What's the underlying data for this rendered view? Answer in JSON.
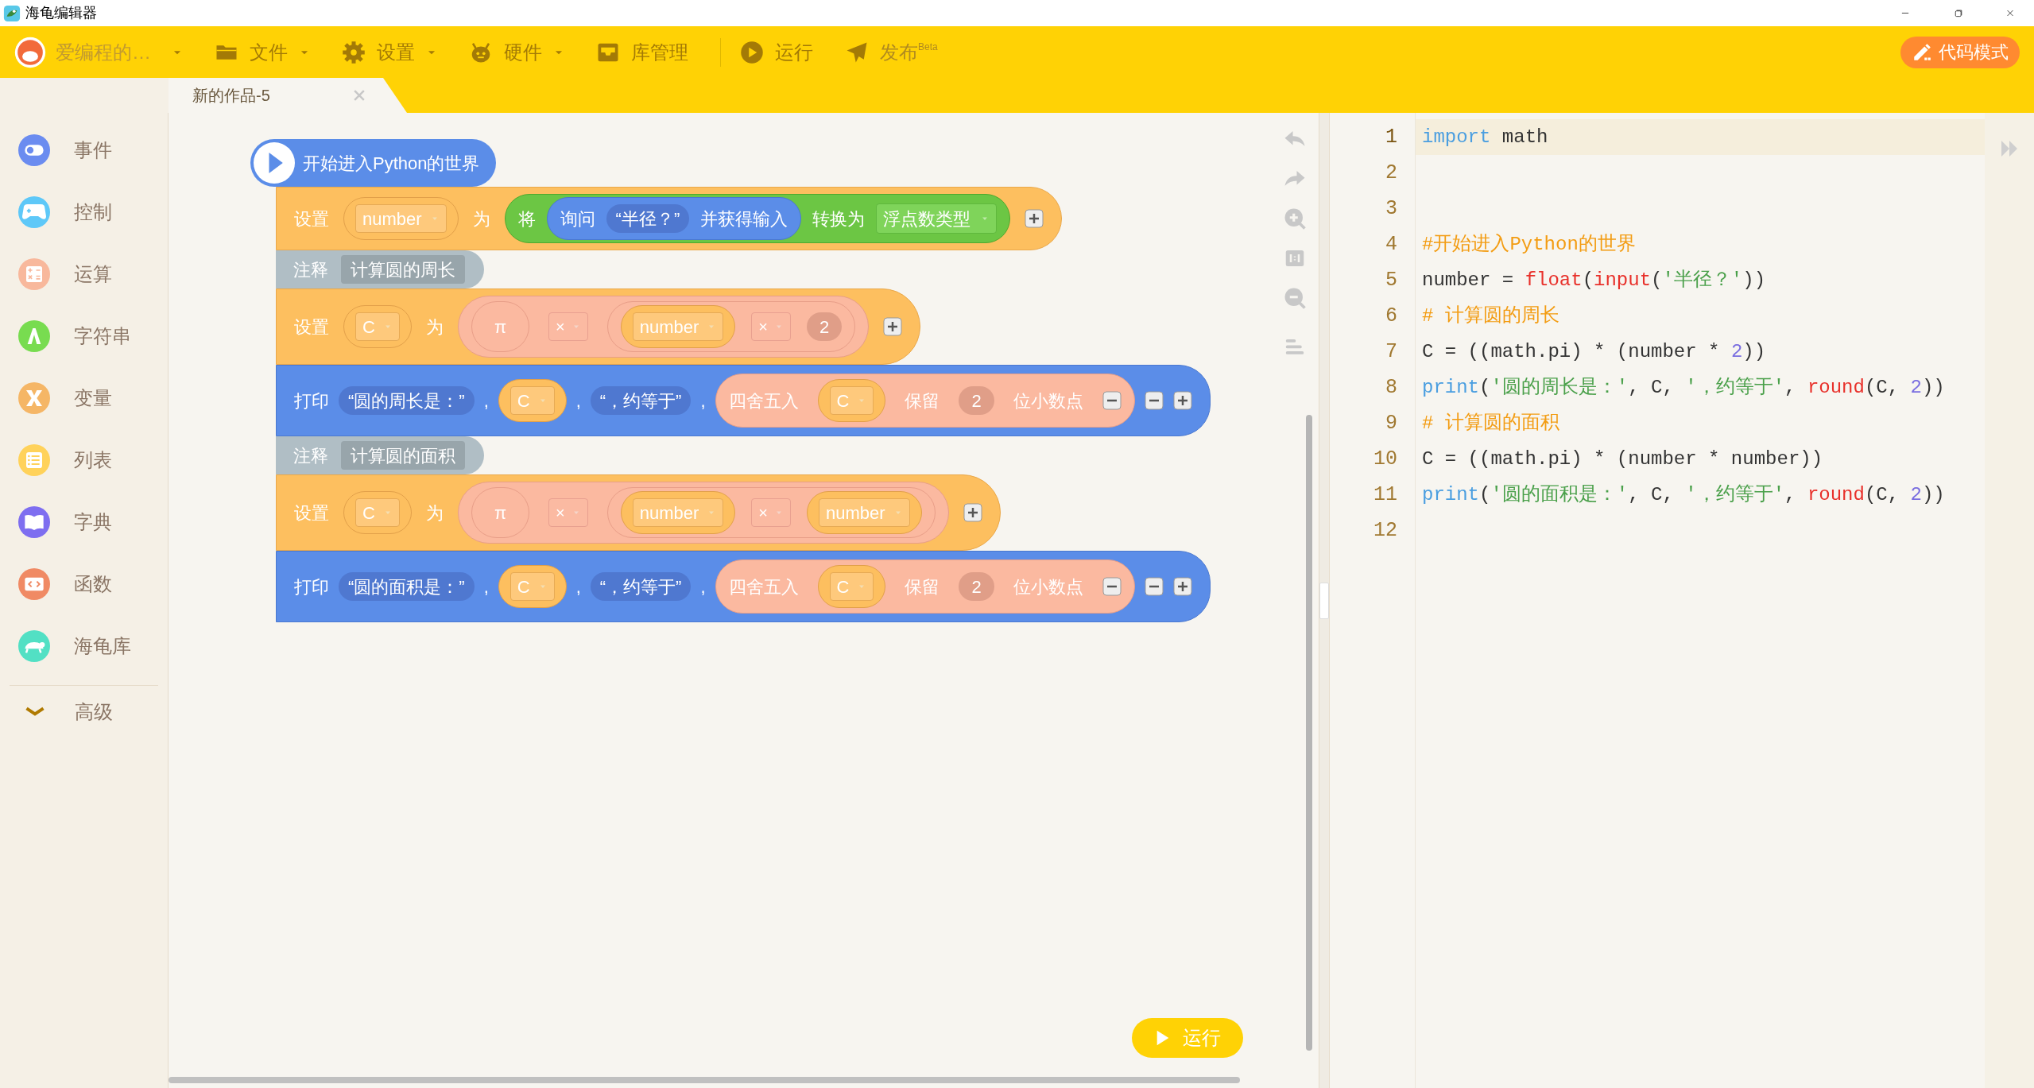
{
  "window": {
    "title": "海龟编辑器"
  },
  "toolbar": {
    "user": "爱编程的…",
    "items": [
      {
        "label": "文件",
        "kind": "menu"
      },
      {
        "label": "设置",
        "kind": "menu"
      },
      {
        "label": "硬件",
        "kind": "menu"
      },
      {
        "label": "库管理",
        "kind": "action"
      },
      {
        "label": "运行",
        "kind": "action"
      },
      {
        "label": "发布",
        "kind": "publish",
        "badge": "Beta"
      }
    ],
    "mode_button": "代码模式"
  },
  "tabs": [
    {
      "label": "新的作品-5",
      "selected": true
    }
  ],
  "categories": [
    {
      "label": "事件",
      "color": "#6b8cf0"
    },
    {
      "label": "控制",
      "color": "#5ec8f8"
    },
    {
      "label": "运算",
      "color": "#f8b89c"
    },
    {
      "label": "字符串",
      "color": "#78dc50"
    },
    {
      "label": "变量",
      "color": "#f5b666"
    },
    {
      "label": "列表",
      "color": "#ffd25a"
    },
    {
      "label": "字典",
      "color": "#7e6ef0"
    },
    {
      "label": "函数",
      "color": "#f08a64"
    },
    {
      "label": "海龟库",
      "color": "#52e0c4"
    }
  ],
  "advanced": "高级",
  "blocks": [
    {
      "kind": "start",
      "label": "开始进入Python的世界"
    },
    {
      "kind": "set",
      "parts": [
        {
          "kind": "label",
          "text": "设置"
        },
        {
          "kind": "var",
          "text": "number"
        },
        {
          "kind": "label",
          "text": "为"
        },
        {
          "kind": "convert",
          "parts": [
            {
              "kind": "label",
              "text": "将"
            },
            {
              "kind": "ask",
              "parts": [
                {
                  "kind": "label",
                  "text": "询问"
                },
                {
                  "kind": "string",
                  "text": "“半径？”"
                },
                {
                  "kind": "label",
                  "text": "并获得输入"
                }
              ]
            },
            {
              "kind": "label",
              "text": "转换为"
            },
            {
              "kind": "dropdown",
              "text": "浮点数类型"
            }
          ]
        },
        {
          "kind": "plus"
        }
      ]
    },
    {
      "kind": "comment",
      "parts": [
        {
          "kind": "label",
          "text": "注释"
        },
        {
          "kind": "note",
          "text": "计算圆的周长"
        }
      ]
    },
    {
      "kind": "set",
      "parts": [
        {
          "kind": "label",
          "text": "设置"
        },
        {
          "kind": "var",
          "text": "C"
        },
        {
          "kind": "label",
          "text": "为"
        },
        {
          "kind": "arith",
          "parts": [
            {
              "kind": "const",
              "text": "π"
            },
            {
              "kind": "op",
              "text": "×"
            },
            {
              "kind": "inner",
              "parts": [
                {
                  "kind": "var",
                  "text": "number"
                },
                {
                  "kind": "op",
                  "text": "×"
                },
                {
                  "kind": "num",
                  "text": "2"
                }
              ]
            }
          ]
        },
        {
          "kind": "plus"
        }
      ]
    },
    {
      "kind": "print",
      "parts": [
        {
          "kind": "label",
          "text": "打印"
        },
        {
          "kind": "string",
          "text": "“圆的周长是：”"
        },
        {
          "kind": "label",
          "text": ","
        },
        {
          "kind": "var",
          "text": "C"
        },
        {
          "kind": "label",
          "text": ","
        },
        {
          "kind": "string",
          "text": "“，约等于”"
        },
        {
          "kind": "label",
          "text": ","
        },
        {
          "kind": "arith",
          "parts": [
            {
              "kind": "label",
              "text": "四舍五入"
            },
            {
              "kind": "var",
              "text": "C"
            },
            {
              "kind": "label",
              "text": "保留"
            },
            {
              "kind": "num",
              "text": "2"
            },
            {
              "kind": "label",
              "text": "位小数点"
            },
            {
              "kind": "minus"
            }
          ]
        },
        {
          "kind": "minus"
        },
        {
          "kind": "plus"
        }
      ]
    },
    {
      "kind": "comment",
      "parts": [
        {
          "kind": "label",
          "text": "注释"
        },
        {
          "kind": "note",
          "text": "计算圆的面积"
        }
      ]
    },
    {
      "kind": "set",
      "parts": [
        {
          "kind": "label",
          "text": "设置"
        },
        {
          "kind": "var",
          "text": "C"
        },
        {
          "kind": "label",
          "text": "为"
        },
        {
          "kind": "arith",
          "parts": [
            {
              "kind": "const",
              "text": "π"
            },
            {
              "kind": "op",
              "text": "×"
            },
            {
              "kind": "inner",
              "parts": [
                {
                  "kind": "var",
                  "text": "number"
                },
                {
                  "kind": "op",
                  "text": "×"
                },
                {
                  "kind": "var",
                  "text": "number"
                }
              ]
            }
          ]
        },
        {
          "kind": "plus"
        }
      ]
    },
    {
      "kind": "print",
      "parts": [
        {
          "kind": "label",
          "text": "打印"
        },
        {
          "kind": "string",
          "text": "“圆的面积是：”"
        },
        {
          "kind": "label",
          "text": ","
        },
        {
          "kind": "var",
          "text": "C"
        },
        {
          "kind": "label",
          "text": ","
        },
        {
          "kind": "string",
          "text": "“，约等于”"
        },
        {
          "kind": "label",
          "text": ","
        },
        {
          "kind": "arith",
          "parts": [
            {
              "kind": "label",
              "text": "四舍五入"
            },
            {
              "kind": "var",
              "text": "C"
            },
            {
              "kind": "label",
              "text": "保留"
            },
            {
              "kind": "num",
              "text": "2"
            },
            {
              "kind": "label",
              "text": "位小数点"
            },
            {
              "kind": "minus"
            }
          ]
        },
        {
          "kind": "minus"
        },
        {
          "kind": "plus"
        }
      ]
    }
  ],
  "run_button": "运行",
  "code": [
    {
      "number": "1",
      "active": true,
      "tokens": [
        {
          "t": "import",
          "kind": "keyword"
        },
        {
          "t": " math",
          "kind": "plain"
        }
      ]
    },
    {
      "number": "2",
      "active": false
    },
    {
      "number": "3",
      "active": false
    },
    {
      "number": "4",
      "active": false,
      "tokens": [
        {
          "t": "#开始进入Python的世界",
          "kind": "comment"
        }
      ]
    },
    {
      "number": "5",
      "active": false,
      "tokens": [
        {
          "t": "number = ",
          "kind": "plain"
        },
        {
          "t": "float",
          "kind": "builtin"
        },
        {
          "t": "(",
          "kind": "plain"
        },
        {
          "t": "input",
          "kind": "builtin"
        },
        {
          "t": "(",
          "kind": "plain"
        },
        {
          "t": "'半径？'",
          "kind": "string"
        },
        {
          "t": "))",
          "kind": "plain"
        }
      ]
    },
    {
      "number": "6",
      "active": false,
      "tokens": [
        {
          "t": "# 计算圆的周长",
          "kind": "comment"
        }
      ]
    },
    {
      "number": "7",
      "active": false,
      "tokens": [
        {
          "t": "C = ((math.pi) * (number * ",
          "kind": "plain"
        },
        {
          "t": "2",
          "kind": "number"
        },
        {
          "t": "))",
          "kind": "plain"
        }
      ]
    },
    {
      "number": "8",
      "active": false,
      "tokens": [
        {
          "t": "print",
          "kind": "keyword"
        },
        {
          "t": "(",
          "kind": "plain"
        },
        {
          "t": "'圆的周长是：'",
          "kind": "string"
        },
        {
          "t": ", C, ",
          "kind": "plain"
        },
        {
          "t": "'，约等于'",
          "kind": "string"
        },
        {
          "t": ", ",
          "kind": "plain"
        },
        {
          "t": "round",
          "kind": "builtin"
        },
        {
          "t": "(C, ",
          "kind": "plain"
        },
        {
          "t": "2",
          "kind": "number"
        },
        {
          "t": "))",
          "kind": "plain"
        }
      ]
    },
    {
      "number": "9",
      "active": false,
      "tokens": [
        {
          "t": "# 计算圆的面积",
          "kind": "comment"
        }
      ]
    },
    {
      "number": "10",
      "active": false,
      "tokens": [
        {
          "t": "C = ((math.pi) * (number * number))",
          "kind": "plain"
        }
      ]
    },
    {
      "number": "11",
      "active": false,
      "tokens": [
        {
          "t": "print",
          "kind": "keyword"
        },
        {
          "t": "(",
          "kind": "plain"
        },
        {
          "t": "'圆的面积是：'",
          "kind": "string"
        },
        {
          "t": ", C, ",
          "kind": "plain"
        },
        {
          "t": "'，约等于'",
          "kind": "string"
        },
        {
          "t": ", ",
          "kind": "plain"
        },
        {
          "t": "round",
          "kind": "builtin"
        },
        {
          "t": "(C, ",
          "kind": "plain"
        },
        {
          "t": "2",
          "kind": "number"
        },
        {
          "t": "))",
          "kind": "plain"
        }
      ]
    },
    {
      "number": "12",
      "active": false
    }
  ]
}
